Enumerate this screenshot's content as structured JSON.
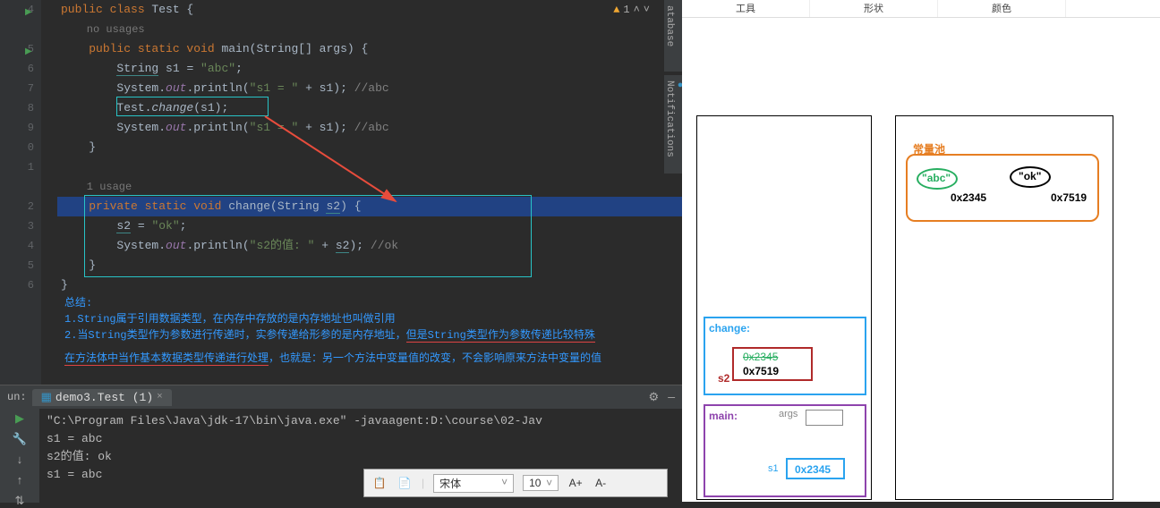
{
  "editor": {
    "lines": [
      {
        "n": "4",
        "run": true,
        "fold": "⊖",
        "html": "public class Test {",
        "cls": "kw"
      },
      {
        "n": "",
        "html": "no usages",
        "usage": true
      },
      {
        "n": "5",
        "run": true,
        "fold": "⊖",
        "html": "public static void main(String[] args) {"
      },
      {
        "n": "6",
        "html": "String s1 = \"abc\";"
      },
      {
        "n": "7",
        "html": "System.out.println(\"s1 = \" + s1); //abc"
      },
      {
        "n": "8",
        "html": "Test.change(s1);"
      },
      {
        "n": "9",
        "html": "System.out.println(\"s1 = \" + s1); //abc"
      },
      {
        "n": "0",
        "fold": "⊝",
        "html": "}"
      },
      {
        "n": "1",
        "html": ""
      },
      {
        "n": "",
        "html": "1 usage",
        "usage": true
      },
      {
        "n": "2",
        "fold": "⊖",
        "html": "private static void change(String s2) {",
        "sel": true
      },
      {
        "n": "3",
        "html": "s2 = \"ok\";"
      },
      {
        "n": "4",
        "html": "System.out.println(\"s2的值: \" + s2); //ok"
      },
      {
        "n": "5",
        "fold": "⊝",
        "html": "}"
      },
      {
        "n": "6",
        "html": "}"
      }
    ],
    "warn_count": "1",
    "side_tab1": "atabase",
    "side_tab2": "Notifications",
    "notes": [
      "总结:",
      "1.String属于引用数据类型，在内存中存放的是内存地址也叫做引用",
      "2.当String类型作为参数进行传递时，实参传递给形参的是内存地址，",
      "但是String类型作为参数传递比较特殊",
      "在方法体中当作基本数据类型传递进行处理",
      "，也就是：另一个方法中变量值的改变，不会影响原来方法中变量的值"
    ]
  },
  "run": {
    "label": "un:",
    "tab": "demo3.Test (1)",
    "out": [
      "\"C:\\Program Files\\Java\\jdk-17\\bin\\java.exe\" -javaagent:D:\\course\\02-Jav",
      "s1 = abc",
      "s2的值: ok",
      "s1 = abc"
    ]
  },
  "fmt": {
    "font": "宋体",
    "size": "10",
    "aplus": "A+",
    "aminus": "A-"
  },
  "diagram": {
    "tabs": [
      "工具",
      "形状",
      "颜色"
    ],
    "pool_label": "常量池",
    "abc": "\"abc\"",
    "abc_addr": "0x2345",
    "ok": "\"ok\"",
    "ok_addr": "0x7519",
    "change_label": "change:",
    "s2_label": "s2",
    "s2_val_old": "0x2345",
    "s2_val": "0x7519",
    "main_label": "main:",
    "args_label": "args",
    "s1_label": "s1",
    "s1_val": "0x2345"
  }
}
